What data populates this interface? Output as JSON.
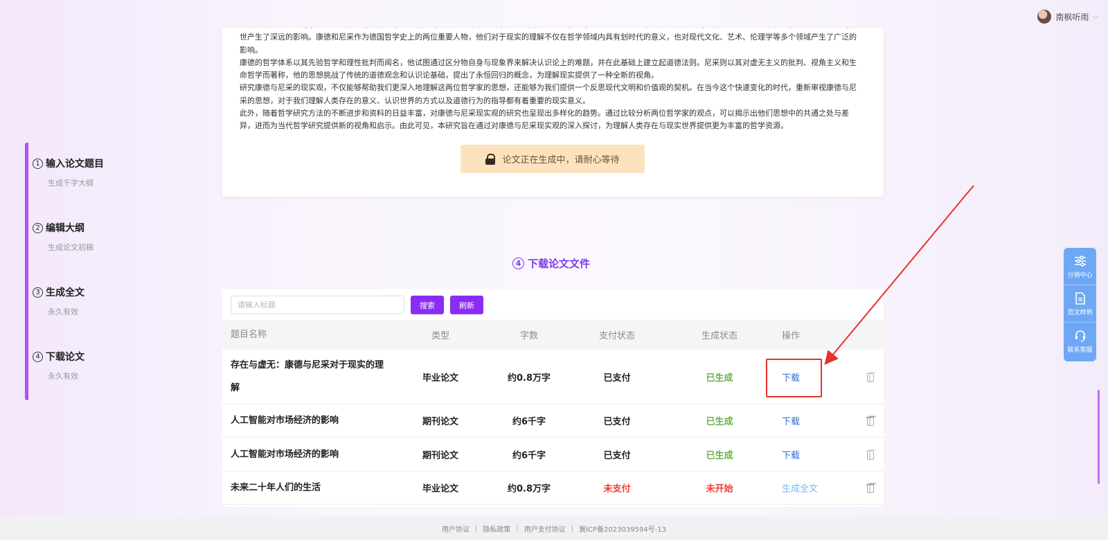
{
  "user": {
    "name": "南枫听雨",
    "chevron": "⌵"
  },
  "steps": [
    {
      "num": "1",
      "title": "输入论文题目",
      "sub": "生成千字大纲"
    },
    {
      "num": "2",
      "title": "编辑大纲",
      "sub": "生成论文初稿"
    },
    {
      "num": "3",
      "title": "生成全文",
      "sub": "永久有效"
    },
    {
      "num": "4",
      "title": "下载论文",
      "sub": "永久有效"
    }
  ],
  "article": {
    "paragraphs": [
      "在探讨康德与尼采对于现实的理解之前，首先考虑到需要明确研究的背景。哲学作为一门探讨人类存在意义和世界本质的学科，其发展历史中涌现出众多思想家，他们的思想和理论对后世产生了深远的影响。康德和尼采作为德国哲学史上的两位重要人物，他们对于现实的理解不仅在哲学领域内具有划时代的意义，也对现代文化、艺术、伦理学等多个领域产生了广泛的影响。",
      "康德的哲学体系以其先验哲学和理性批判而闻名，他试图通过区分物自身与现象界来解决认识论上的难题，并在此基础上建立起道德法则。尼采则以其对虚无主义的批判、视角主义和生命哲学而著称，他的思想挑战了传统的道德观念和认识论基础，提出了永恒回归的概念，为理解现实提供了一种全新的视角。",
      "研究康德与尼采的现实观，不仅能够帮助我们更深入地理解这两位哲学家的思想，还能够为我们提供一个反思现代文明和价值观的契机。在当今这个快速变化的时代，重新审视康德与尼采的思想，对于我们理解人类存在的意义、认识世界的方式以及道德行为的指导都有着重要的现实意义。",
      "此外，随着哲学研究方法的不断进步和资料的日益丰富，对康德与尼采现实观的研究也呈现出多样化的趋势。通过比较分析两位哲学家的观点，可以揭示出他们思想中的共通之处与差异，进而为当代哲学研究提供新的视角和启示。由此可见，本研究旨在通过对康德与尼采现实观的深入探讨，为理解人类存在与现实世界提供更为丰富的哲学资源。"
    ],
    "generating_label": "论文正在生成中，请耐心等待"
  },
  "section": {
    "num": "4",
    "title": "下载论文文件"
  },
  "toolbar": {
    "search_placeholder": "请输入标题",
    "search_value": "",
    "search_label": "搜索",
    "refresh_label": "刷新"
  },
  "table": {
    "headers": {
      "title": "题目名称",
      "type": "类型",
      "words": "字数",
      "pay": "支付状态",
      "gen": "生成状态",
      "op": "操作"
    },
    "rows": [
      {
        "title": "存在与虚无：康德与尼采对于现实的理解",
        "type": "毕业论文",
        "words": "约0.8万字",
        "pay": "已支付",
        "gen": "已生成",
        "op": "下载"
      },
      {
        "title": "人工智能对市场经济的影响",
        "type": "期刊论文",
        "words": "约6千字",
        "pay": "已支付",
        "gen": "已生成",
        "op": "下载"
      },
      {
        "title": "人工智能对市场经济的影响",
        "type": "期刊论文",
        "words": "约6千字",
        "pay": "已支付",
        "gen": "已生成",
        "op": "下载"
      },
      {
        "title": "未来二十年人们的生活",
        "type": "毕业论文",
        "words": "约0.8万字",
        "pay": "未支付",
        "gen": "未开始",
        "op": "生成全文"
      }
    ]
  },
  "float_panel": [
    {
      "label": "分销中心",
      "icon": "sliders-icon"
    },
    {
      "label": "范文样例",
      "icon": "document-icon"
    },
    {
      "label": "联系客服",
      "icon": "headset-icon"
    }
  ],
  "footer": {
    "links": [
      "用户协议",
      "隐私政策",
      "用户支付协议",
      "冀ICP备2023039594号-13"
    ],
    "separator": "|"
  },
  "colors": {
    "accent": "#8b2cf5",
    "green": "#67b346",
    "red": "#f23a2b",
    "link": "#2d6fd4",
    "annotation": "#e5322d"
  }
}
